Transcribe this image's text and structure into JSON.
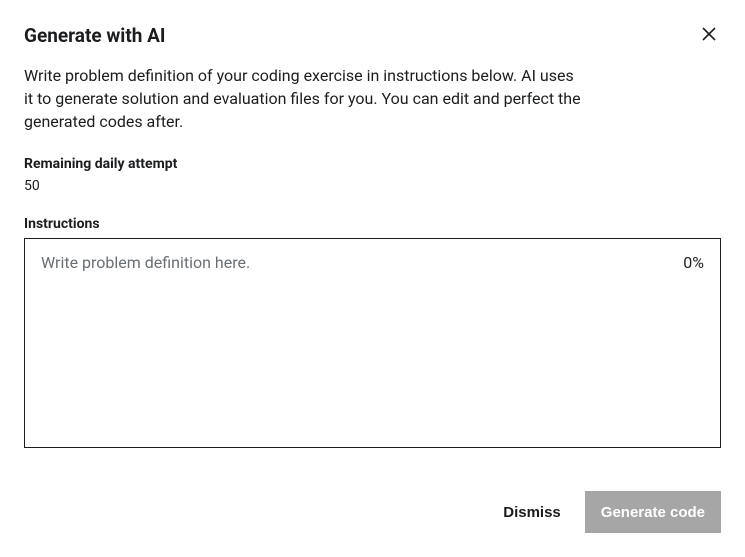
{
  "modal": {
    "title": "Generate with AI",
    "description": "Write problem definition of your coding exercise in instructions below. AI uses it to generate solution and evaluation files for you. You can edit and perfect the generated codes after.",
    "remaining_label": "Remaining daily attempt",
    "remaining_value": "50",
    "instructions_label": "Instructions",
    "instructions_placeholder": "Write problem definition here.",
    "instructions_value": "",
    "percent_indicator": "0%",
    "dismiss_label": "Dismiss",
    "generate_label": "Generate code"
  }
}
